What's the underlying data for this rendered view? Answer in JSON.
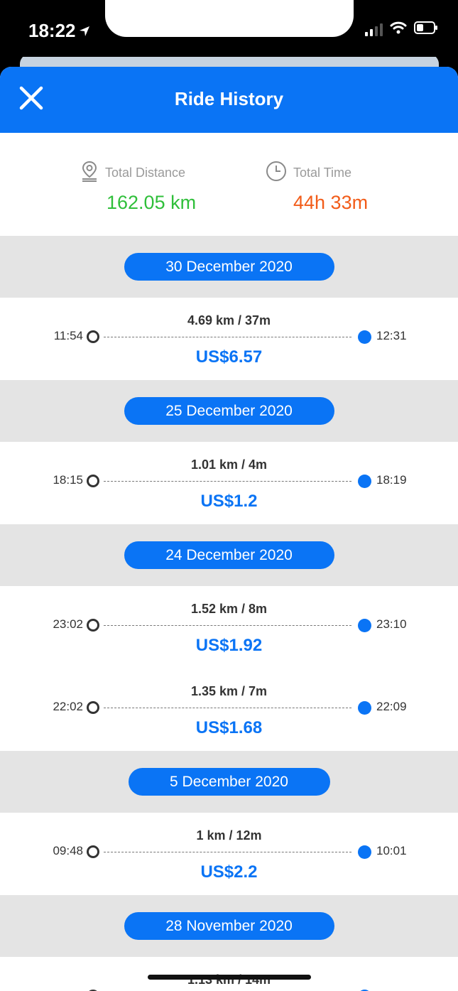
{
  "status": {
    "time": "18:22"
  },
  "nav": {
    "title": "Ride History"
  },
  "totals": {
    "distance_label": "Total Distance",
    "distance_value": "162.05 km",
    "time_label": "Total Time",
    "time_value": "44h 33m"
  },
  "colors": {
    "accent": "#0a74f5",
    "distance": "#2fbf3a",
    "time": "#f25c19"
  },
  "groups": [
    {
      "date": "30 December 2020",
      "rides": [
        {
          "summary": "4.69 km / 37m",
          "start": "11:54",
          "end": "12:31",
          "price": "US$6.57"
        }
      ]
    },
    {
      "date": "25 December 2020",
      "rides": [
        {
          "summary": "1.01 km / 4m",
          "start": "18:15",
          "end": "18:19",
          "price": "US$1.2"
        }
      ]
    },
    {
      "date": "24 December 2020",
      "rides": [
        {
          "summary": "1.52 km / 8m",
          "start": "23:02",
          "end": "23:10",
          "price": "US$1.92"
        },
        {
          "summary": "1.35 km / 7m",
          "start": "22:02",
          "end": "22:09",
          "price": "US$1.68"
        }
      ]
    },
    {
      "date": "5 December 2020",
      "rides": [
        {
          "summary": "1 km / 12m",
          "start": "09:48",
          "end": "10:01",
          "price": "US$2.2"
        }
      ]
    },
    {
      "date": "28 November 2020",
      "rides": [
        {
          "summary": "1.13 km / 14m"
        }
      ]
    }
  ]
}
